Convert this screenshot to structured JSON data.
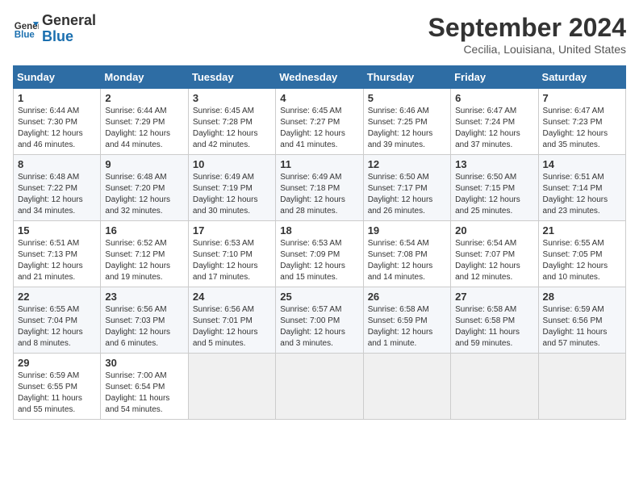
{
  "logo": {
    "text_general": "General",
    "text_blue": "Blue"
  },
  "header": {
    "month_title": "September 2024",
    "location": "Cecilia, Louisiana, United States"
  },
  "weekdays": [
    "Sunday",
    "Monday",
    "Tuesday",
    "Wednesday",
    "Thursday",
    "Friday",
    "Saturday"
  ],
  "weeks": [
    [
      {
        "day": "1",
        "sunrise": "6:44 AM",
        "sunset": "7:30 PM",
        "daylight": "12 hours and 46 minutes."
      },
      {
        "day": "2",
        "sunrise": "6:44 AM",
        "sunset": "7:29 PM",
        "daylight": "12 hours and 44 minutes."
      },
      {
        "day": "3",
        "sunrise": "6:45 AM",
        "sunset": "7:28 PM",
        "daylight": "12 hours and 42 minutes."
      },
      {
        "day": "4",
        "sunrise": "6:45 AM",
        "sunset": "7:27 PM",
        "daylight": "12 hours and 41 minutes."
      },
      {
        "day": "5",
        "sunrise": "6:46 AM",
        "sunset": "7:25 PM",
        "daylight": "12 hours and 39 minutes."
      },
      {
        "day": "6",
        "sunrise": "6:47 AM",
        "sunset": "7:24 PM",
        "daylight": "12 hours and 37 minutes."
      },
      {
        "day": "7",
        "sunrise": "6:47 AM",
        "sunset": "7:23 PM",
        "daylight": "12 hours and 35 minutes."
      }
    ],
    [
      {
        "day": "8",
        "sunrise": "6:48 AM",
        "sunset": "7:22 PM",
        "daylight": "12 hours and 34 minutes."
      },
      {
        "day": "9",
        "sunrise": "6:48 AM",
        "sunset": "7:20 PM",
        "daylight": "12 hours and 32 minutes."
      },
      {
        "day": "10",
        "sunrise": "6:49 AM",
        "sunset": "7:19 PM",
        "daylight": "12 hours and 30 minutes."
      },
      {
        "day": "11",
        "sunrise": "6:49 AM",
        "sunset": "7:18 PM",
        "daylight": "12 hours and 28 minutes."
      },
      {
        "day": "12",
        "sunrise": "6:50 AM",
        "sunset": "7:17 PM",
        "daylight": "12 hours and 26 minutes."
      },
      {
        "day": "13",
        "sunrise": "6:50 AM",
        "sunset": "7:15 PM",
        "daylight": "12 hours and 25 minutes."
      },
      {
        "day": "14",
        "sunrise": "6:51 AM",
        "sunset": "7:14 PM",
        "daylight": "12 hours and 23 minutes."
      }
    ],
    [
      {
        "day": "15",
        "sunrise": "6:51 AM",
        "sunset": "7:13 PM",
        "daylight": "12 hours and 21 minutes."
      },
      {
        "day": "16",
        "sunrise": "6:52 AM",
        "sunset": "7:12 PM",
        "daylight": "12 hours and 19 minutes."
      },
      {
        "day": "17",
        "sunrise": "6:53 AM",
        "sunset": "7:10 PM",
        "daylight": "12 hours and 17 minutes."
      },
      {
        "day": "18",
        "sunrise": "6:53 AM",
        "sunset": "7:09 PM",
        "daylight": "12 hours and 15 minutes."
      },
      {
        "day": "19",
        "sunrise": "6:54 AM",
        "sunset": "7:08 PM",
        "daylight": "12 hours and 14 minutes."
      },
      {
        "day": "20",
        "sunrise": "6:54 AM",
        "sunset": "7:07 PM",
        "daylight": "12 hours and 12 minutes."
      },
      {
        "day": "21",
        "sunrise": "6:55 AM",
        "sunset": "7:05 PM",
        "daylight": "12 hours and 10 minutes."
      }
    ],
    [
      {
        "day": "22",
        "sunrise": "6:55 AM",
        "sunset": "7:04 PM",
        "daylight": "12 hours and 8 minutes."
      },
      {
        "day": "23",
        "sunrise": "6:56 AM",
        "sunset": "7:03 PM",
        "daylight": "12 hours and 6 minutes."
      },
      {
        "day": "24",
        "sunrise": "6:56 AM",
        "sunset": "7:01 PM",
        "daylight": "12 hours and 5 minutes."
      },
      {
        "day": "25",
        "sunrise": "6:57 AM",
        "sunset": "7:00 PM",
        "daylight": "12 hours and 3 minutes."
      },
      {
        "day": "26",
        "sunrise": "6:58 AM",
        "sunset": "6:59 PM",
        "daylight": "12 hours and 1 minute."
      },
      {
        "day": "27",
        "sunrise": "6:58 AM",
        "sunset": "6:58 PM",
        "daylight": "11 hours and 59 minutes."
      },
      {
        "day": "28",
        "sunrise": "6:59 AM",
        "sunset": "6:56 PM",
        "daylight": "11 hours and 57 minutes."
      }
    ],
    [
      {
        "day": "29",
        "sunrise": "6:59 AM",
        "sunset": "6:55 PM",
        "daylight": "11 hours and 55 minutes."
      },
      {
        "day": "30",
        "sunrise": "7:00 AM",
        "sunset": "6:54 PM",
        "daylight": "11 hours and 54 minutes."
      },
      null,
      null,
      null,
      null,
      null
    ]
  ]
}
